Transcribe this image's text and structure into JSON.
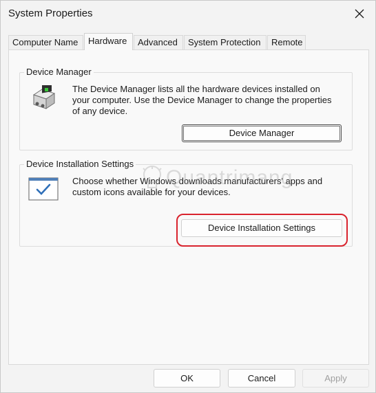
{
  "window": {
    "title": "System Properties",
    "close_icon": "close-icon"
  },
  "tabs": [
    {
      "label": "Computer Name",
      "active": false
    },
    {
      "label": "Hardware",
      "active": true
    },
    {
      "label": "Advanced",
      "active": false
    },
    {
      "label": "System Protection",
      "active": false
    },
    {
      "label": "Remote",
      "active": false
    }
  ],
  "device_manager": {
    "legend": "Device Manager",
    "icon": "device-manager-icon",
    "description": "The Device Manager lists all the hardware devices installed on your computer. Use the Device Manager to change the properties of any device.",
    "desc_line1": "The Device Manager lists all the hardware devices installed on",
    "desc_line2": "your computer. Use the Device Manager to change the properties",
    "desc_line3": "of any device.",
    "button_label": "Device Manager"
  },
  "device_installation": {
    "legend": "Device Installation Settings",
    "icon": "checkbox-window-icon",
    "desc_line1": "Choose whether Windows downloads manufacturers' apps and",
    "desc_line2": "custom icons available for your devices.",
    "button_label": "Device Installation Settings",
    "highlight_color": "#d9232d"
  },
  "footer": {
    "ok_label": "OK",
    "cancel_label": "Cancel",
    "apply_label": "Apply"
  },
  "watermark": {
    "text": "Quantrimang"
  }
}
